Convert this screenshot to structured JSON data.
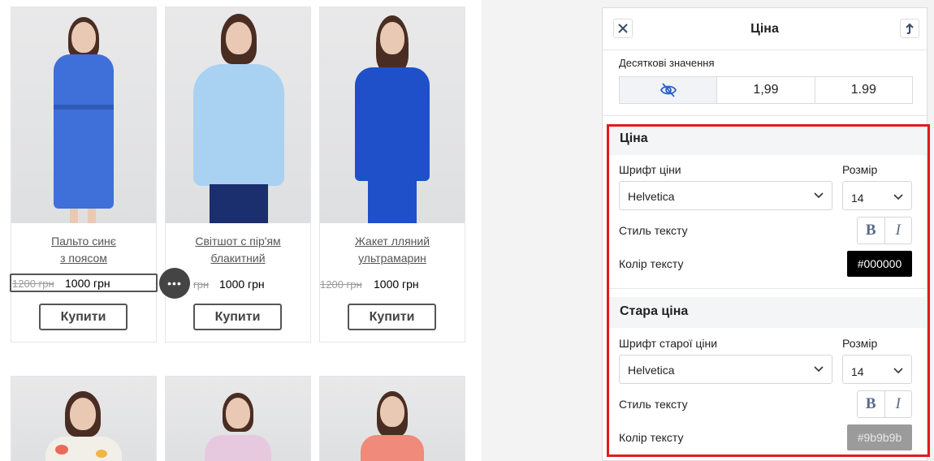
{
  "products": [
    {
      "name_line1": "Пальто синє",
      "name_line2": "з поясом",
      "old_price": "1200 грн",
      "price": "1000 грн",
      "buy_label": "Купити",
      "garment_color": "#3f6fd8"
    },
    {
      "name_line1": "Світшот с пір'ям",
      "name_line2": "блакитний",
      "old_price": "грн",
      "price": "1000 грн",
      "buy_label": "Купити",
      "garment_color": "#a9d1f2"
    },
    {
      "name_line1": "Жакет лляний",
      "name_line2": "ультрамарин",
      "old_price": "1200 грн",
      "price": "1000 грн",
      "buy_label": "Купити",
      "garment_color": "#1f4fc9"
    }
  ],
  "more_button_label": "•••",
  "panel": {
    "title": "Ціна",
    "decimals_label": "Десяткові значення",
    "decimal_options": [
      "",
      "1,99",
      "1.99"
    ],
    "price_section": {
      "title": "Ціна",
      "font_label": "Шрифт ціни",
      "font_value": "Helvetica",
      "size_label": "Розмір",
      "size_value": "14",
      "style_label": "Стиль тексту",
      "bold": "B",
      "italic": "I",
      "color_label": "Колір тексту",
      "color_value": "#000000"
    },
    "old_price_section": {
      "title": "Стара ціна",
      "font_label": "Шрифт старої ціни",
      "font_value": "Helvetica",
      "size_label": "Розмір",
      "size_value": "14",
      "style_label": "Стиль тексту",
      "bold": "B",
      "italic": "I",
      "color_label": "Колір тексту",
      "color_value": "#9b9b9b"
    }
  },
  "colors": {
    "accent_highlight": "#e21b1b",
    "old_price_text": "#9b9b9b"
  }
}
